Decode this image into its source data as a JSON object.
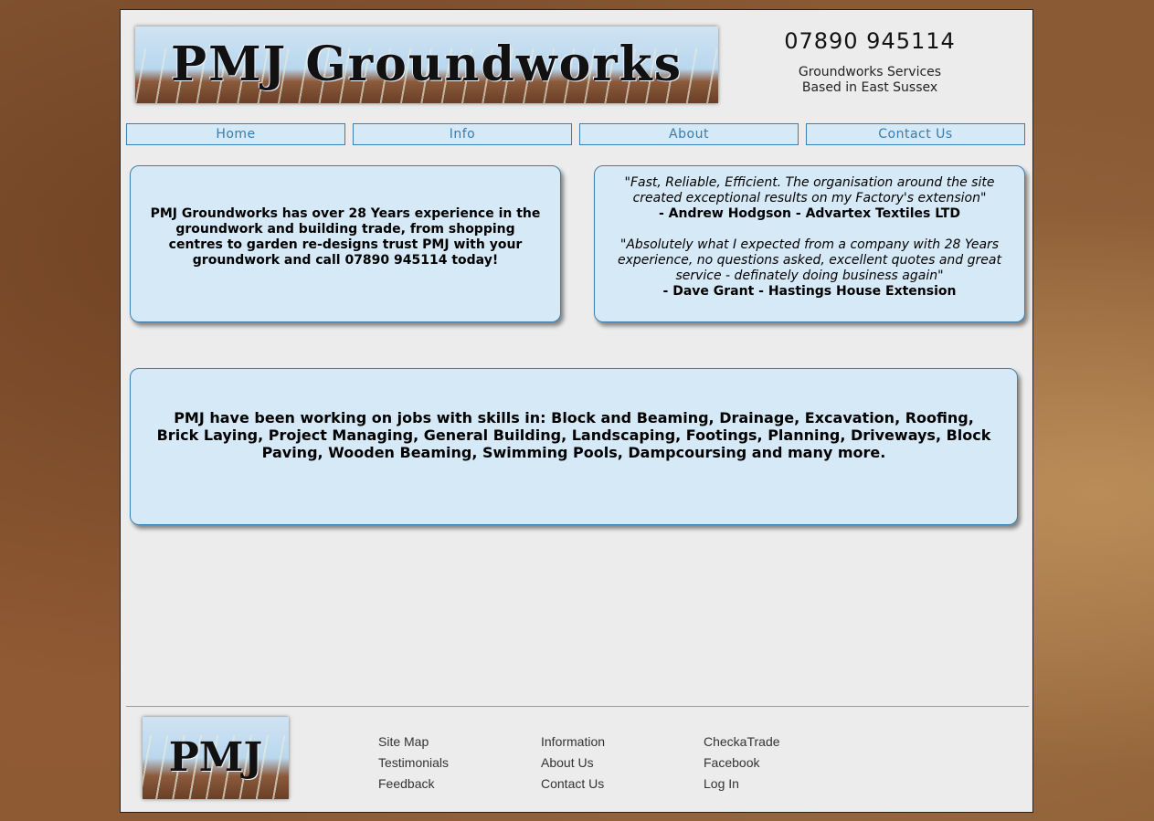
{
  "header": {
    "logo_text": "PMJ Groundworks",
    "phone": "07890 945114",
    "tagline_1": "Groundworks Services",
    "tagline_2": "Based in East Sussex"
  },
  "nav": {
    "items": [
      {
        "label": "Home"
      },
      {
        "label": "Info"
      },
      {
        "label": "About"
      },
      {
        "label": "Contact Us"
      }
    ]
  },
  "intro": {
    "text": "PMJ Groundworks has over 28 Years experience in the groundwork and building trade, from shopping centres to garden re-designs trust PMJ with your groundwork and call 07890 945114 today!"
  },
  "testimonials": [
    {
      "quote": "\"Fast, Reliable, Efficient. The organisation around the site created exceptional results on my Factory's extension\"",
      "author": "- Andrew Hodgson - Advartex Textiles LTD"
    },
    {
      "quote": "\"Absolutely what I expected from a company with 28 Years experience, no questions asked, excellent quotes and great service - definately doing business again\"",
      "author": "- Dave Grant - Hastings House Extension"
    }
  ],
  "skills": {
    "text": "PMJ have been working on jobs with skills in: Block and Beaming, Drainage, Excavation, Roofing, Brick Laying, Project Managing, General Building, Landscaping, Footings, Planning, Driveways, Block Paving, Wooden Beaming, Swimming Pools, Dampcoursing and many more."
  },
  "footer": {
    "logo_text": "PMJ",
    "col1": [
      "Site Map",
      "Testimonials",
      "Feedback"
    ],
    "col2": [
      "Information",
      "About Us",
      "Contact Us"
    ],
    "col3": [
      "CheckaTrade",
      "Facebook",
      "Log In"
    ]
  },
  "colors": {
    "panel_bg": "#d6e9f6",
    "panel_border": "#3f7fae",
    "nav_text": "#3a7cab",
    "page_bg": "#ececec"
  }
}
